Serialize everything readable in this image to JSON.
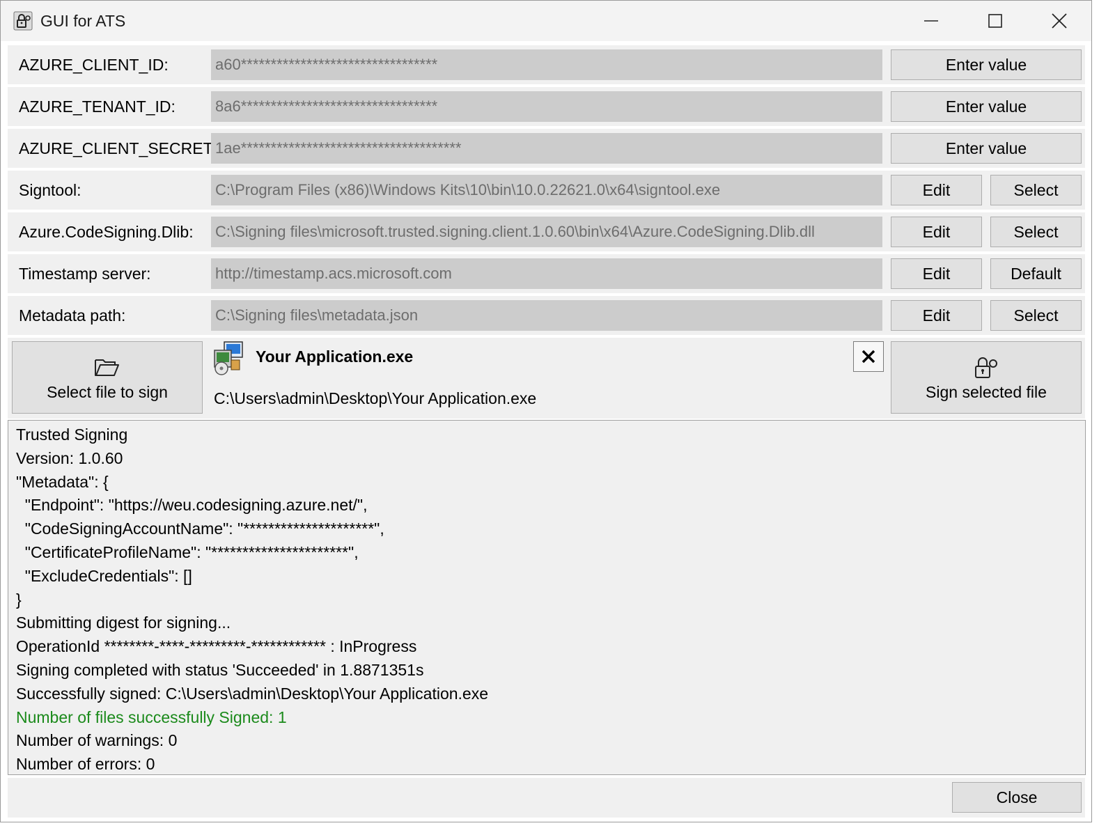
{
  "window": {
    "title": "GUI for ATS",
    "icon": "lock-key-icon",
    "controls": [
      "minimize-icon",
      "maximize-icon",
      "close-icon"
    ]
  },
  "settings": {
    "client_id": {
      "label": "AZURE_CLIENT_ID:",
      "value": "a60*********************************",
      "button": "Enter value"
    },
    "tenant_id": {
      "label": "AZURE_TENANT_ID:",
      "value": "8a6*********************************",
      "button": "Enter value"
    },
    "client_secret": {
      "label": "AZURE_CLIENT_SECRET:",
      "value": "1ae*************************************",
      "button": "Enter value"
    },
    "signtool": {
      "label": "Signtool:",
      "value": "C:\\Program Files (x86)\\Windows Kits\\10\\bin\\10.0.22621.0\\x64\\signtool.exe",
      "edit": "Edit",
      "action": "Select"
    },
    "dlib": {
      "label": "Azure.CodeSigning.Dlib:",
      "value": "C:\\Signing files\\microsoft.trusted.signing.client.1.0.60\\bin\\x64\\Azure.CodeSigning.Dlib.dll",
      "edit": "Edit",
      "action": "Select"
    },
    "timestamp": {
      "label": "Timestamp server:",
      "value": "http://timestamp.acs.microsoft.com",
      "edit": "Edit",
      "action": "Default"
    },
    "metadata": {
      "label": "Metadata path:",
      "value": "C:\\Signing files\\metadata.json",
      "edit": "Edit",
      "action": "Select"
    }
  },
  "file": {
    "select_button": "Select file to sign",
    "name": "Your Application.exe",
    "path": "C:\\Users\\admin\\Desktop\\Your Application.exe",
    "clear_icon": "x-icon",
    "sign_button": "Sign selected file"
  },
  "log": {
    "lines": [
      "Trusted Signing",
      "Version: 1.0.60",
      "\"Metadata\": {",
      "  \"Endpoint\": \"https://weu.codesigning.azure.net/\",",
      "  \"CodeSigningAccountName\": \"*********************\",",
      "  \"CertificateProfileName\": \"**********************\",",
      "  \"ExcludeCredentials\": []",
      "}",
      "Submitting digest for signing...",
      "OperationId ********-****-*********-************ : InProgress",
      "Signing completed with status 'Succeeded' in 1.8871351s",
      "Successfully signed: C:\\Users\\admin\\Desktop\\Your Application.exe",
      "Number of files successfully Signed: 1",
      "Number of warnings: 0",
      "Number of errors: 0"
    ],
    "success_color": "#1b8a1b"
  },
  "footer": {
    "close_button": "Close"
  }
}
